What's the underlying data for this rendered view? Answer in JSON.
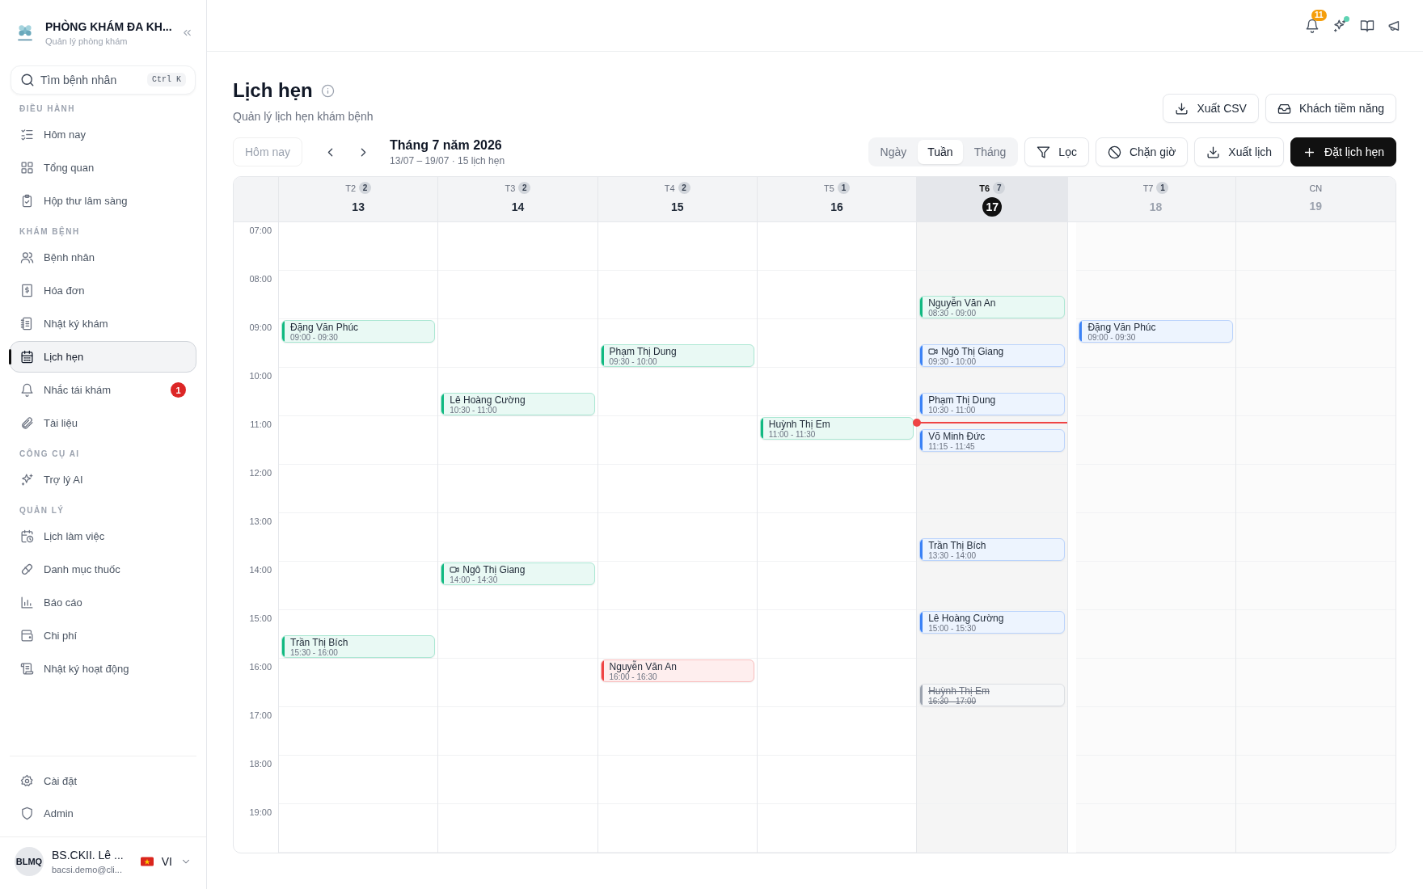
{
  "sidebar": {
    "brand": {
      "title": "PHÒNG KHÁM ĐA KH...",
      "subtitle": "Quản lý phòng khám"
    },
    "search": {
      "placeholder": "Tìm bệnh nhân",
      "shortcut": "Ctrl K"
    },
    "sections": [
      {
        "title": "ĐIỀU HÀNH",
        "items": [
          {
            "label": "Hôm nay",
            "selected": false
          },
          {
            "label": "Tổng quan",
            "selected": false
          },
          {
            "label": "Hộp thư lâm sàng",
            "selected": false
          }
        ]
      },
      {
        "title": "KHÁM BỆNH",
        "items": [
          {
            "label": "Bệnh nhân",
            "selected": false
          },
          {
            "label": "Hóa đơn",
            "selected": false
          },
          {
            "label": "Nhật ký khám",
            "selected": false
          },
          {
            "label": "Lịch hẹn",
            "selected": true
          },
          {
            "label": "Nhắc tái khám",
            "selected": false,
            "badge": "1"
          },
          {
            "label": "Tài liệu",
            "selected": false
          }
        ]
      },
      {
        "title": "CÔNG CỤ AI",
        "items": [
          {
            "label": "Trợ lý AI",
            "selected": false
          }
        ]
      },
      {
        "title": "QUẢN LÝ",
        "items": [
          {
            "label": "Lịch làm việc",
            "selected": false
          },
          {
            "label": "Danh mục thuốc",
            "selected": false
          },
          {
            "label": "Báo cáo",
            "selected": false
          },
          {
            "label": "Chi phí",
            "selected": false
          },
          {
            "label": "Nhật ký hoạt động",
            "selected": false
          }
        ]
      }
    ],
    "footer_items": [
      {
        "label": "Cài đặt",
        "selected": false
      },
      {
        "label": "Admin",
        "selected": false
      }
    ],
    "user": {
      "initials": "BLMQ",
      "name": "BS.CKII. Lê ...",
      "email": "bacsi.demo@cli...",
      "language": "VI"
    }
  },
  "topbar": {
    "notifications": "11",
    "assistant_dot": true
  },
  "page": {
    "title": "Lịch hẹn",
    "subtitle": "Quản lý lịch hẹn khám bệnh",
    "actions": [
      {
        "label": "Xuất CSV"
      },
      {
        "label": "Khách tiềm năng"
      }
    ]
  },
  "toolbar": {
    "today_button": {
      "label": "Hôm nay",
      "disabled": true
    },
    "period": "Tháng 7 năm 2026",
    "range": "13/07 – 19/07 · 15 lịch hẹn",
    "views": [
      {
        "label": "Ngày",
        "selected": false
      },
      {
        "label": "Tuần",
        "selected": true
      },
      {
        "label": "Tháng",
        "selected": false
      }
    ],
    "buttons": [
      {
        "label": "Lọc",
        "kind": "outline"
      },
      {
        "label": "Chặn giờ",
        "kind": "outline"
      },
      {
        "label": "Xuất lịch",
        "kind": "outline"
      },
      {
        "label": "Đặt lịch hẹn",
        "kind": "primary"
      }
    ]
  },
  "calendar": {
    "hours": [
      "07:00",
      "08:00",
      "09:00",
      "10:00",
      "11:00",
      "12:00",
      "13:00",
      "14:00",
      "15:00",
      "16:00",
      "17:00",
      "18:00",
      "19:00"
    ],
    "days": [
      {
        "weekday": "T2",
        "count": "2",
        "date": "13",
        "today": false,
        "weekend": false,
        "events": [
          {
            "name": "Đặng Văn Phúc",
            "time": "09:00 - 09:30",
            "color": "#10b981",
            "video": false,
            "cancelled": false
          },
          {
            "name": "Trần Thị Bích",
            "time": "15:30 - 16:00",
            "color": "#10b981",
            "video": false,
            "cancelled": false
          }
        ]
      },
      {
        "weekday": "T3",
        "count": "2",
        "date": "14",
        "today": false,
        "weekend": false,
        "events": [
          {
            "name": "Lê Hoàng Cường",
            "time": "10:30 - 11:00",
            "color": "#10b981",
            "video": false,
            "cancelled": false
          },
          {
            "name": "Ngô Thị Giang",
            "time": "14:00 - 14:30",
            "color": "#10b981",
            "video": true,
            "cancelled": false
          }
        ]
      },
      {
        "weekday": "T4",
        "count": "2",
        "date": "15",
        "today": false,
        "weekend": false,
        "events": [
          {
            "name": "Phạm Thị Dung",
            "time": "09:30 - 10:00",
            "color": "#10b981",
            "video": false,
            "cancelled": false
          },
          {
            "name": "Nguyễn Văn An",
            "time": "16:00 - 16:30",
            "color": "#ef4444",
            "video": false,
            "cancelled": false
          }
        ]
      },
      {
        "weekday": "T5",
        "count": "1",
        "date": "16",
        "today": false,
        "weekend": false,
        "events": [
          {
            "name": "Huỳnh Thị Em",
            "time": "11:00 - 11:30",
            "color": "#10b981",
            "video": false,
            "cancelled": false
          }
        ]
      },
      {
        "weekday": "T6",
        "count": "7",
        "date": "17",
        "today": true,
        "weekend": false,
        "now_marker": true,
        "events": [
          {
            "name": "Nguyễn Văn An",
            "time": "08:30 - 09:00",
            "color": "#10b981",
            "video": false,
            "cancelled": false
          },
          {
            "name": "Ngô Thị Giang",
            "time": "09:30 - 10:00",
            "color": "#3b82f6",
            "video": true,
            "cancelled": false
          },
          {
            "name": "Phạm Thị Dung",
            "time": "10:30 - 11:00",
            "color": "#3b82f6",
            "video": false,
            "cancelled": false
          },
          {
            "name": "Võ Minh Đức",
            "time": "11:15 - 11:45",
            "color": "#3b82f6",
            "video": false,
            "cancelled": false
          },
          {
            "name": "Trần Thị Bích",
            "time": "13:30 - 14:00",
            "color": "#3b82f6",
            "video": false,
            "cancelled": false
          },
          {
            "name": "Lê Hoàng Cường",
            "time": "15:00 - 15:30",
            "color": "#3b82f6",
            "video": false,
            "cancelled": false
          },
          {
            "name": "Huỳnh Thị Em",
            "time": "16:30 - 17:00",
            "color": "#9ca3af",
            "video": false,
            "cancelled": true
          }
        ]
      },
      {
        "weekday": "T7",
        "count": "1",
        "date": "18",
        "today": false,
        "weekend": true,
        "events": [
          {
            "name": "Đặng Văn Phúc",
            "time": "09:00 - 09:30",
            "color": "#3b82f6",
            "video": false,
            "cancelled": false
          }
        ]
      },
      {
        "weekday": "CN",
        "date": "19",
        "today": false,
        "weekend": true
      }
    ]
  }
}
